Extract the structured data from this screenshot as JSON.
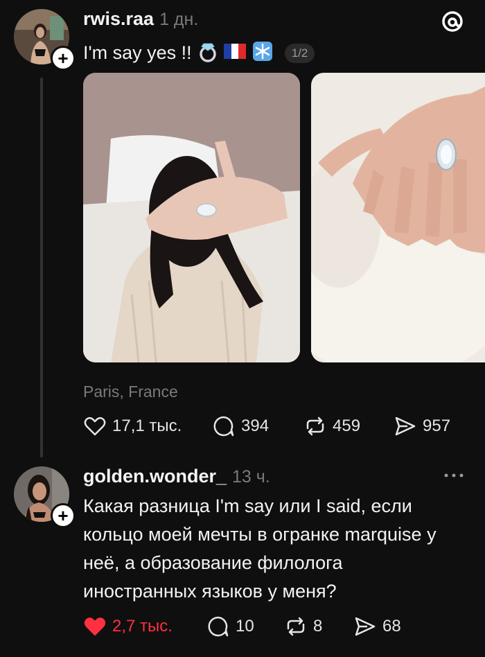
{
  "post": {
    "username": "rwis.raa",
    "time": "1 дн.",
    "text": "I'm say yes !!",
    "emojis": [
      "ring",
      "flag-france",
      "snowflake"
    ],
    "pager": "1/2",
    "location": "Paris, France",
    "likes": "17,1 тыс.",
    "comments": "394",
    "reposts": "459",
    "shares": "957"
  },
  "reply": {
    "username": "golden.wonder_",
    "time": "13 ч.",
    "lines": [
      "Какая разница I'm say или I said, если",
      "кольцо моей мечты в огранке marquise у",
      "неё, а образование филолога",
      "иностранных языков у меня?"
    ],
    "likes": "2,7 тыс.",
    "comments": "10",
    "reposts": "8",
    "shares": "68",
    "liked": true
  },
  "colors": {
    "background": "#0f0f0f",
    "like_active": "#ff3040",
    "muted": "#7a7a7a"
  }
}
